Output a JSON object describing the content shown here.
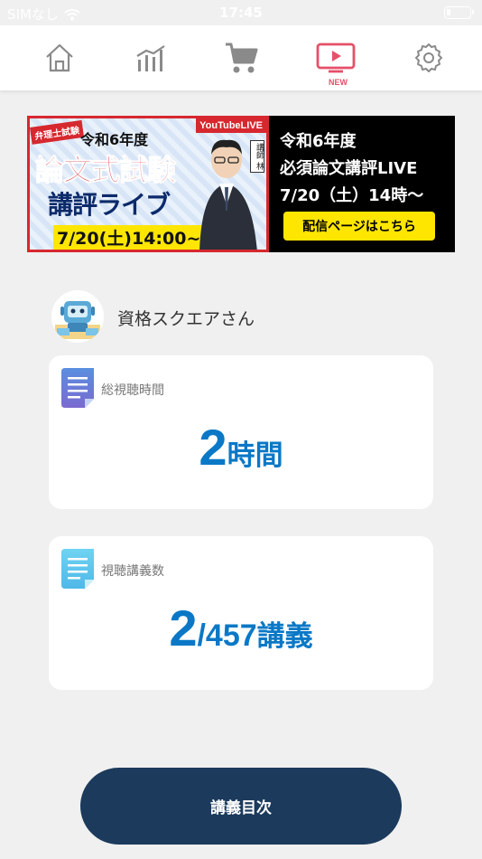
{
  "status_bar": {
    "carrier": "SIMなし",
    "time": "17:45"
  },
  "nav": {
    "items": [
      "home",
      "stats",
      "cart",
      "video",
      "settings"
    ],
    "new_badge": "NEW",
    "accent_color": "#e5506a",
    "icon_color": "#8a8a8a"
  },
  "banner": {
    "tag": "弁理士試験",
    "year": "令和6年度",
    "title": "論文式試験",
    "subtitle": "講評ライブ",
    "date": "7/20(土)14:00~",
    "youtube": "YouTubeLIVE",
    "lecturer": "講師 林",
    "right_line1": "令和6年度",
    "right_line2": "必須論文講評LIVE",
    "right_line3": "7/20（土）14時～",
    "button": "配信ページはこちら"
  },
  "user": {
    "name": "資格スクエアさん"
  },
  "stats": {
    "watch_time": {
      "label": "総視聴時間",
      "value": "2",
      "unit": "時間"
    },
    "lectures": {
      "label": "視聴講義数",
      "value": "2",
      "total": "/457",
      "unit": "講義"
    }
  },
  "main_button": "講義目次",
  "colors": {
    "value_blue": "#0a78c6",
    "button_navy": "#1b3a5c",
    "banner_red": "#d7282f"
  }
}
